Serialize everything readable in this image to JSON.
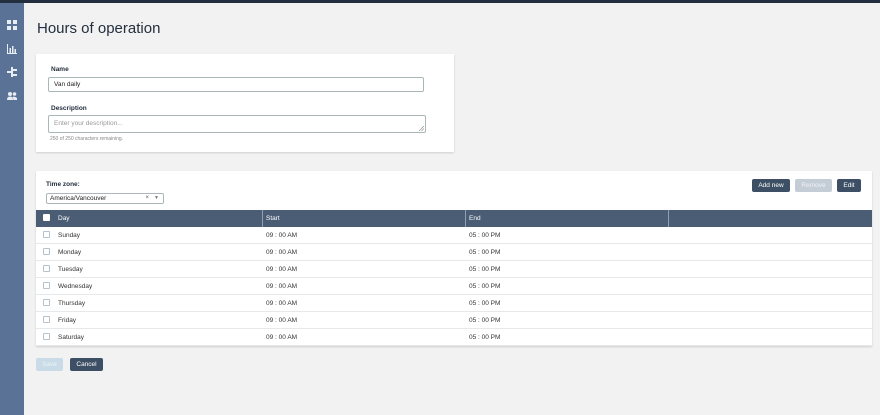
{
  "nav": {
    "icons": [
      "dashboard-icon",
      "metrics-icon",
      "routing-icon",
      "users-icon"
    ]
  },
  "page": {
    "title": "Hours of operation"
  },
  "form": {
    "name_label": "Name",
    "name_value": "Van daily",
    "description_label": "Description",
    "description_placeholder": "Enter your description...",
    "description_help": "250 of 250 characters remaining."
  },
  "schedule": {
    "timezone_label": "Time zone:",
    "timezone_value": "America/Vancouver",
    "timezone_clear": "×",
    "timezone_caret": "▼",
    "add_new_label": "Add new",
    "remove_label": "Remove",
    "edit_label": "Edit",
    "columns": [
      "Day",
      "Start",
      "End"
    ],
    "rows": [
      {
        "day": "Sunday",
        "start": "09 : 00 AM",
        "end": "05 : 00 PM"
      },
      {
        "day": "Monday",
        "start": "09 : 00 AM",
        "end": "05 : 00 PM"
      },
      {
        "day": "Tuesday",
        "start": "09 : 00 AM",
        "end": "05 : 00 PM"
      },
      {
        "day": "Wednesday",
        "start": "09 : 00 AM",
        "end": "05 : 00 PM"
      },
      {
        "day": "Thursday",
        "start": "09 : 00 AM",
        "end": "05 : 00 PM"
      },
      {
        "day": "Friday",
        "start": "09 : 00 AM",
        "end": "05 : 00 PM"
      },
      {
        "day": "Saturday",
        "start": "09 : 00 AM",
        "end": "05 : 00 PM"
      }
    ]
  },
  "actions": {
    "save_label": "Save",
    "cancel_label": "Cancel"
  },
  "colors": {
    "sidebar": "#5a7296",
    "header": "#4a5d75",
    "button": "#3d4f65"
  }
}
